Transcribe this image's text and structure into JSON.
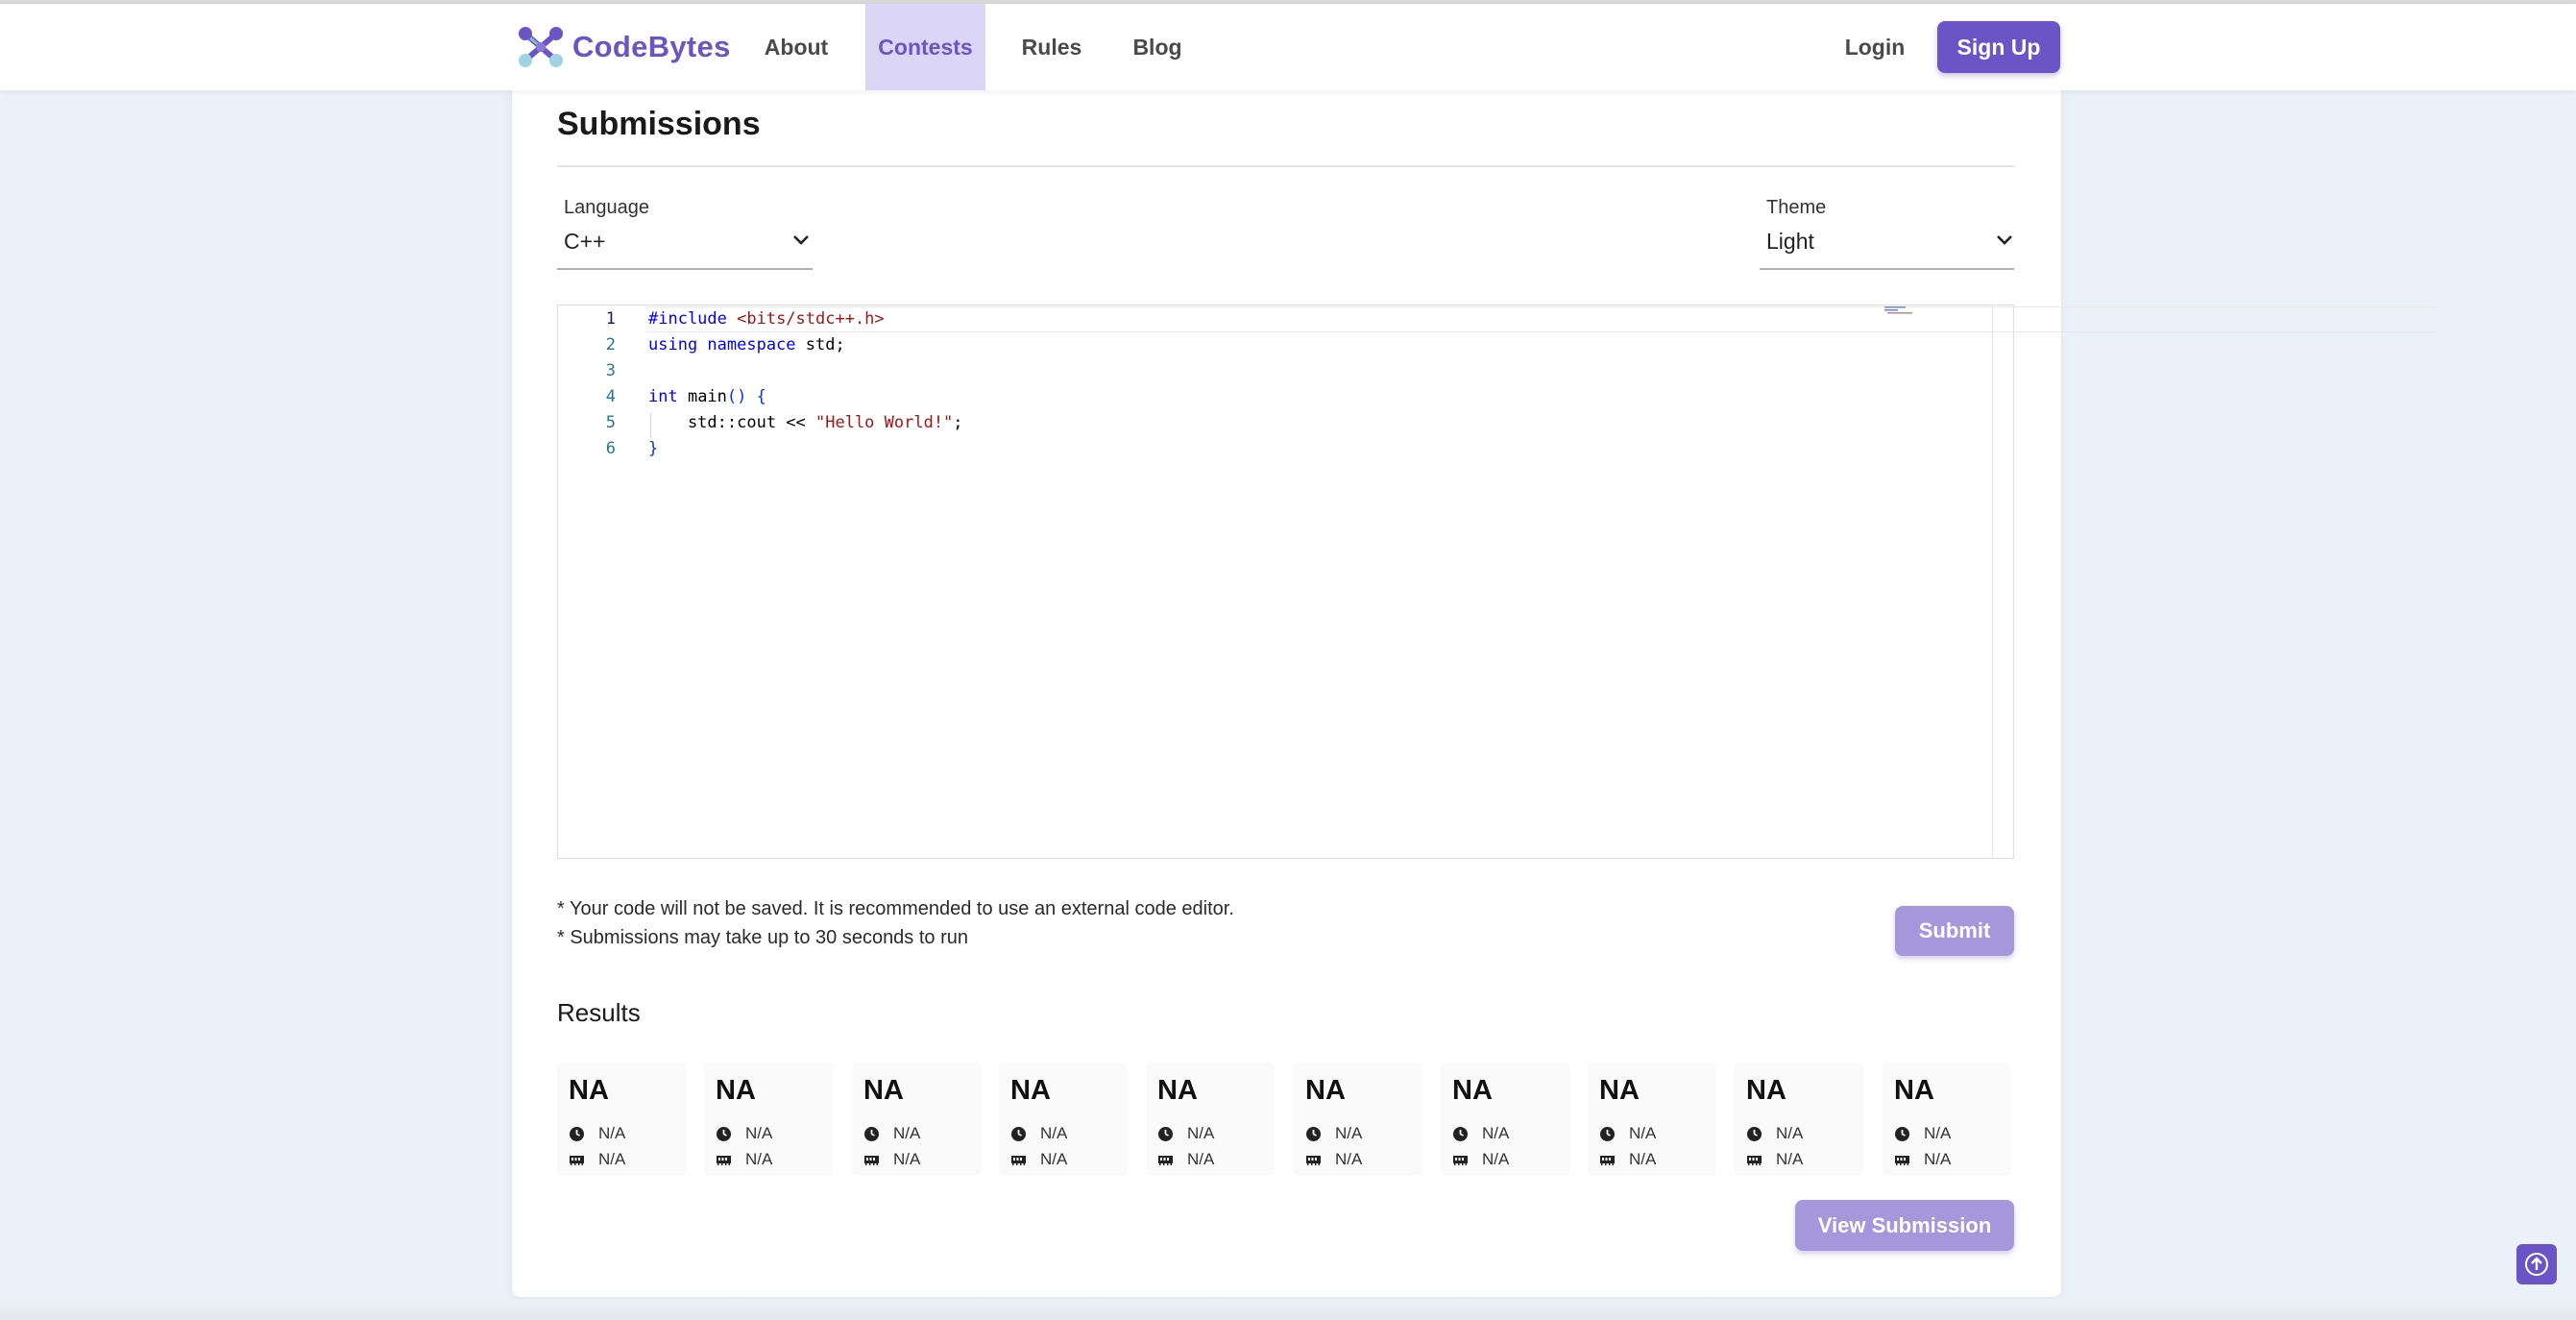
{
  "brand": {
    "name": "CodeBytes",
    "accent": "#6a55c2"
  },
  "nav": {
    "about": "About",
    "contests": "Contests",
    "rules": "Rules",
    "blog": "Blog",
    "login": "Login",
    "signup": "Sign Up",
    "active": "Contests"
  },
  "page": {
    "title": "Submissions"
  },
  "language": {
    "label": "Language",
    "value": "C++"
  },
  "theme": {
    "label": "Theme",
    "value": "Light"
  },
  "editor": {
    "line_numbers": [
      "1",
      "2",
      "3",
      "4",
      "5",
      "6"
    ],
    "active_line": 1,
    "code": [
      "#include <bits/stdc++.h>",
      "using namespace std;",
      "",
      "int main() {",
      "    std::cout << \"Hello World!\";",
      "}"
    ]
  },
  "notes": [
    "* Your code will not be saved. It is recommended to use an external code editor.",
    "* Submissions may take up to 30 seconds to run"
  ],
  "submit_label": "Submit",
  "results": {
    "title": "Results",
    "cases": [
      {
        "status": "NA",
        "time": "N/A",
        "memory": "N/A"
      },
      {
        "status": "NA",
        "time": "N/A",
        "memory": "N/A"
      },
      {
        "status": "NA",
        "time": "N/A",
        "memory": "N/A"
      },
      {
        "status": "NA",
        "time": "N/A",
        "memory": "N/A"
      },
      {
        "status": "NA",
        "time": "N/A",
        "memory": "N/A"
      },
      {
        "status": "NA",
        "time": "N/A",
        "memory": "N/A"
      },
      {
        "status": "NA",
        "time": "N/A",
        "memory": "N/A"
      },
      {
        "status": "NA",
        "time": "N/A",
        "memory": "N/A"
      },
      {
        "status": "NA",
        "time": "N/A",
        "memory": "N/A"
      },
      {
        "status": "NA",
        "time": "N/A",
        "memory": "N/A"
      }
    ]
  },
  "view_submission_label": "View Submission",
  "icons": {
    "logo": "codebytes-logo-icon",
    "dropdown": "chevron-down-icon",
    "time": "clock-icon",
    "memory": "memory-icon",
    "scroll_top": "arrow-up-icon"
  }
}
